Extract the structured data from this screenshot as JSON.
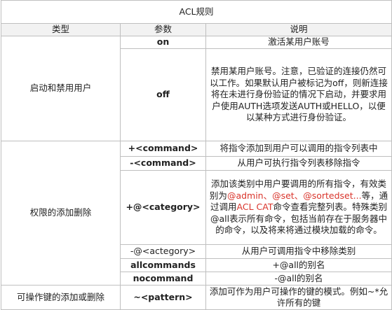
{
  "title": "ACL规则",
  "headers": {
    "type": "类型",
    "param": "参数",
    "desc": "说明"
  },
  "groups": {
    "user": "启动和禁用用户",
    "perm": "权限的添加删除",
    "keys": "可操作键的添加或删除"
  },
  "rows": {
    "on": {
      "param": "on",
      "desc": "激活某用户账号"
    },
    "off": {
      "param": "off",
      "desc": "禁用某用户账号。注意，已验证的连接仍然可以工作。如果默认用户被标记为off，则新连接将在未进行身份验证的情况下启动，并要求用户使用AUTH选项发送AUTH或HELLO，以便以某种方式进行身份验证。"
    },
    "add_cmd": {
      "param": "+<command>",
      "desc": "将指令添加到用户可以调用的指令列表中"
    },
    "rm_cmd": {
      "param": "-<command>",
      "desc": "从用户可执行指令列表移除指令"
    },
    "add_cat": {
      "param": "+@<category>",
      "desc_a": "添加该类别中用户要调用的所有指令，有效类别为",
      "desc_red1": "@admin、@set、@sortedset...",
      "desc_b": "等，通过调用",
      "desc_red2": "ACL CAT",
      "desc_c": "命令查看完整列表。特殊类别@all表示所有命令，包括当前存在于服务器中的命令，以及将来将通过模块加载的命令。"
    },
    "rm_cat": {
      "param": "-@<actegory>",
      "desc": "从用户可调用指令中移除类别"
    },
    "allcommands": {
      "param": "allcommands",
      "desc": "+@all的别名"
    },
    "nocommand": {
      "param": "nocommand",
      "desc": "-@all的别名"
    },
    "pattern": {
      "param": "~<pattern>",
      "desc": "添加可作为用户可操作的键的模式。例如~*允许所有的键"
    }
  },
  "colors": {
    "accent_red": "#d9342b",
    "border": "#bfbfbf",
    "header_bg": "#f2f2f2"
  }
}
